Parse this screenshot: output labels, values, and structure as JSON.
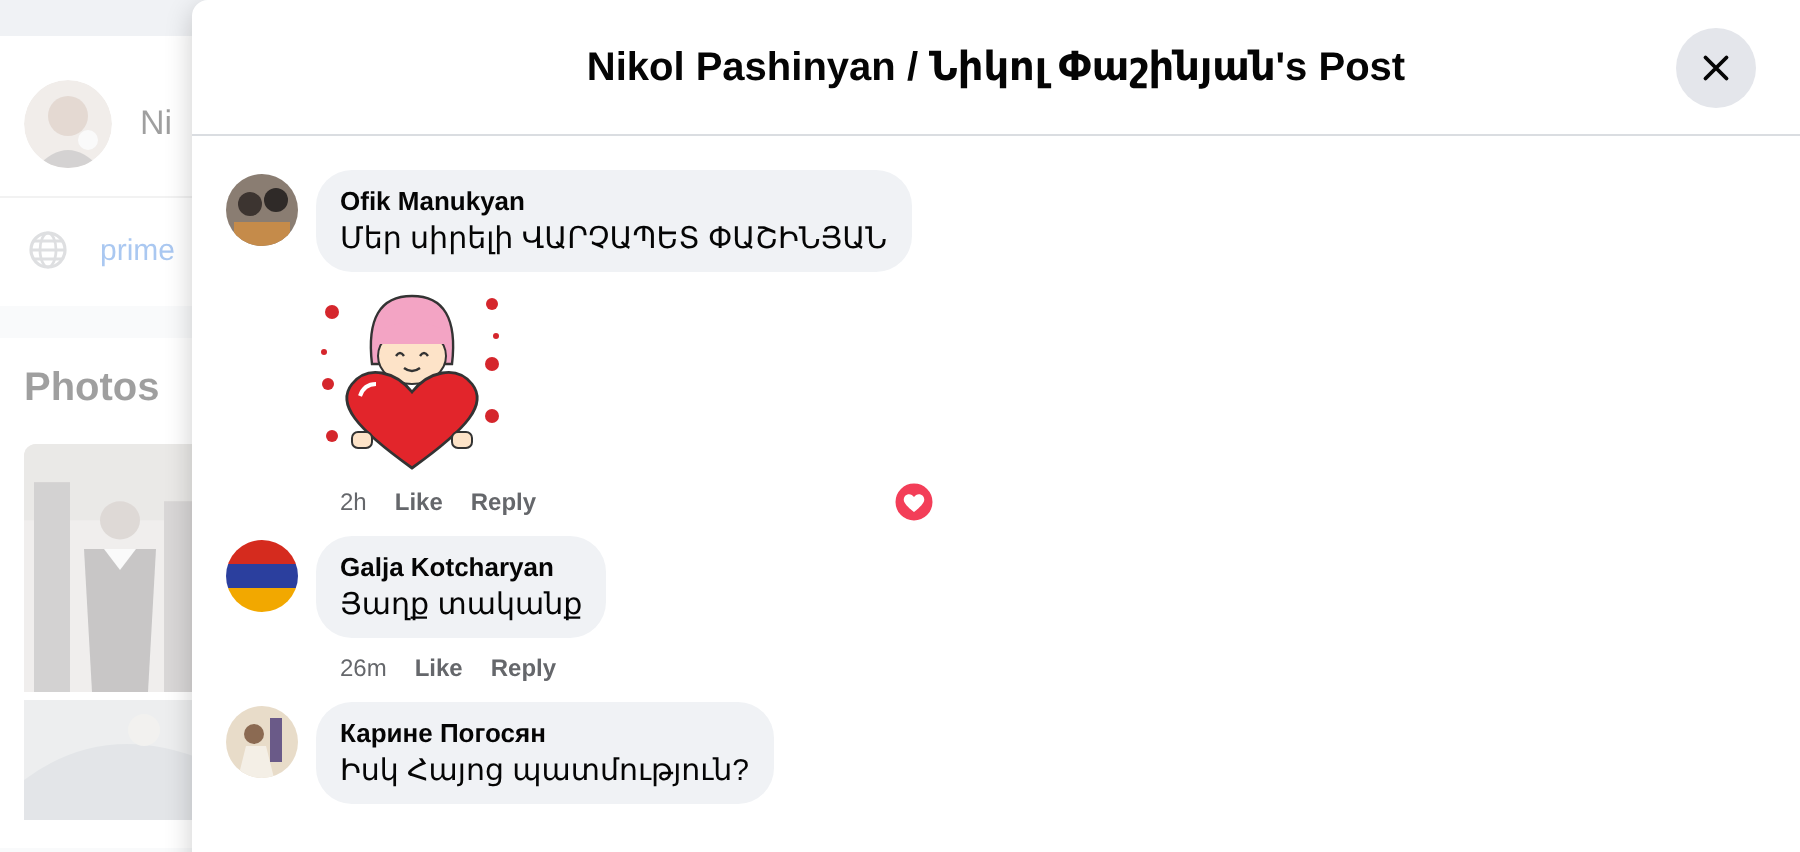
{
  "background": {
    "profile_name": "Ni",
    "link": "prime",
    "photos_heading": "Photos"
  },
  "dialog": {
    "title": "Nikol Pashinyan / Նիկոլ Փաշինյան's Post"
  },
  "comments": [
    {
      "kind": "sticker",
      "author": "Ofik Manukyan",
      "text": "Մեր սիրելի ՎԱՐՉԱՊԵՏ ՓԱՇԻՆՅԱՆ",
      "time": "2h",
      "like": "Like",
      "reply": "Reply",
      "reacted": true
    },
    {
      "kind": "text",
      "author": "Galja Kotcharyan",
      "text": "Յաղք տականք",
      "time": "26m",
      "like": "Like",
      "reply": "Reply",
      "reacted": false
    },
    {
      "kind": "text",
      "author": "Карине Погосян",
      "text": "Իսկ Հայոց պատմություն?",
      "reacted": false
    }
  ]
}
